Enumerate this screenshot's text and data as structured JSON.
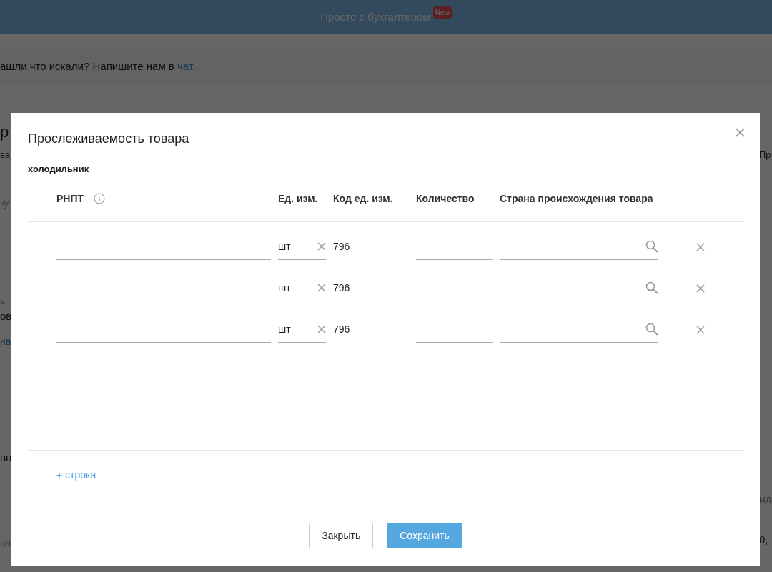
{
  "header": {
    "title": "Просто с бухгалтером",
    "badge": "New"
  },
  "notice": {
    "text": "ашли что искали? Напишите нам в ",
    "link": "чат",
    "end": "."
  },
  "background_left": [
    {
      "kind": "title",
      "text": "р"
    },
    {
      "kind": "tab",
      "text": "ва"
    },
    {
      "kind": "placeholder",
      "text": "ку"
    },
    {
      "kind": "label",
      "text": "ь"
    },
    {
      "kind": "value",
      "text": "ов"
    },
    {
      "kind": "link",
      "text": "на"
    },
    {
      "kind": "value",
      "text": "вн"
    },
    {
      "kind": "link",
      "text": "ва"
    }
  ],
  "background_right": [
    {
      "kind": "tab",
      "text": "Пр"
    },
    {
      "kind": "label",
      "text": "НД"
    },
    {
      "kind": "value",
      "text": "0,"
    }
  ],
  "modal": {
    "title": "Прослеживаемость товара",
    "product": "холодильник",
    "columns": [
      "РНПТ",
      "Ед. изм.",
      "Код ед. изм.",
      "Количество",
      "Страна происхождения товара"
    ],
    "rows": [
      {
        "unit": "шт",
        "code": "796"
      },
      {
        "unit": "шт",
        "code": "796"
      },
      {
        "unit": "шт",
        "code": "796"
      }
    ],
    "add_row": "+ строка",
    "buttons": [
      {
        "kind": "secondary",
        "label": "Закрыть"
      },
      {
        "kind": "primary",
        "label": "Сохранить"
      }
    ]
  }
}
